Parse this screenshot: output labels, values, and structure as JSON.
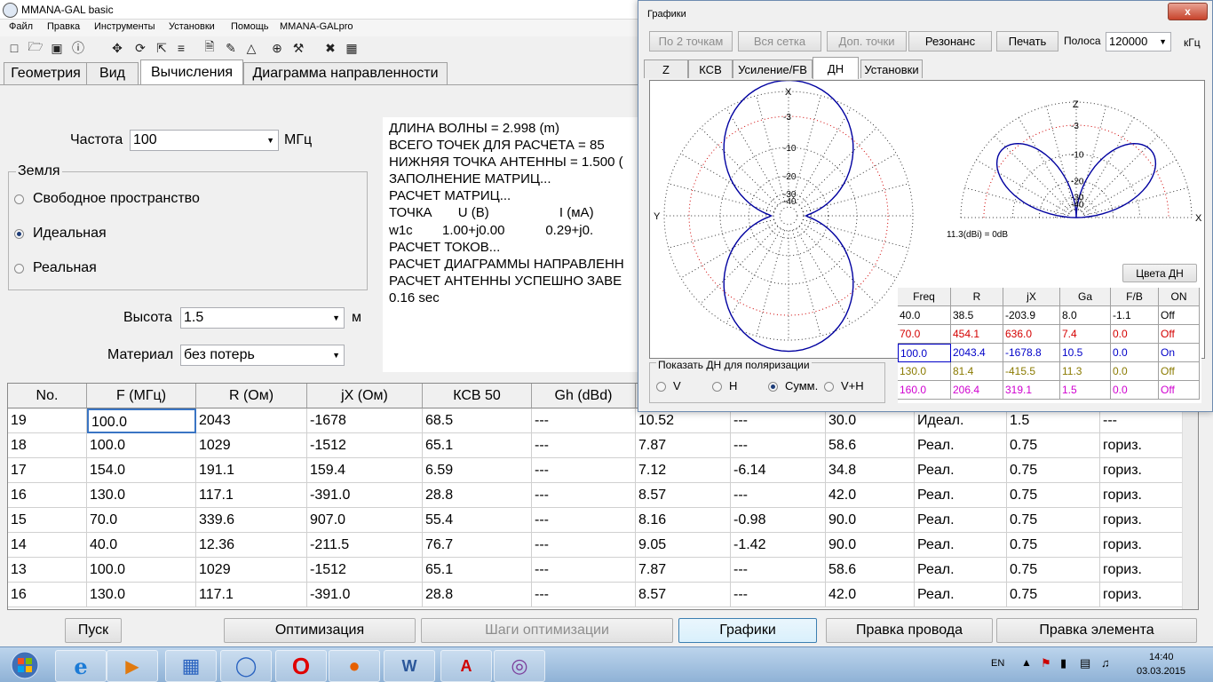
{
  "window": {
    "title": "MMANA-GAL basic"
  },
  "menu": [
    "Файл",
    "Правка",
    "Инструменты",
    "Установки",
    "Помощь",
    "MMANA-GALpro"
  ],
  "tabs": [
    "Геометрия",
    "Вид",
    "Вычисления",
    "Диаграмма направленности"
  ],
  "calc": {
    "freq_label": "Частота",
    "freq_value": "100",
    "freq_unit": "МГц",
    "ground_title": "Земля",
    "ground_options": [
      "Свободное пространство",
      "Идеальная",
      "Реальная"
    ],
    "ground_selected": 1,
    "height_label": "Высота",
    "height_value": "1.5",
    "height_unit": "м",
    "material_label": "Материал",
    "material_value": "без потерь"
  },
  "log": [
    "ДЛИНА ВОЛНЫ = 2.998 (m)",
    "ВСЕГО ТОЧЕК ДЛЯ РАСЧЕТА = 85",
    "НИЖНЯЯ ТОЧКА АНТЕННЫ = 1.500 (",
    "ЗАПОЛНЕНИЕ МАТРИЦ...",
    "РАСЧЕТ МАТРИЦ...",
    "ТОЧКА       U (В)                   I (мА)",
    "w1c        1.00+j0.00           0.29+j0.",
    "РАСЧЕТ ТОКОВ...",
    "РАСЧЕТ ДИАГРАММЫ НАПРАВЛЕНН",
    "РАСЧЕТ АНТЕННЫ УСПЕШНО ЗАВЕ",
    "0.16 sec"
  ],
  "grid": {
    "headers": [
      "No.",
      "F (МГц)",
      "R (Ом)",
      "jX (Ом)",
      "КСВ 50",
      "Gh (dBd)"
    ],
    "rows": [
      [
        "19",
        "100.0",
        "2043",
        "-1678",
        "68.5",
        "---",
        "10.52",
        "---",
        "30.0",
        "Идеал.",
        "1.5",
        "---"
      ],
      [
        "18",
        "100.0",
        "1029",
        "-1512",
        "65.1",
        "---",
        "7.87",
        "---",
        "58.6",
        "Реал.",
        "0.75",
        "гориз."
      ],
      [
        "17",
        "154.0",
        "191.1",
        "159.4",
        "6.59",
        "---",
        "7.12",
        "-6.14",
        "34.8",
        "Реал.",
        "0.75",
        "гориз."
      ],
      [
        "16",
        "130.0",
        "117.1",
        "-391.0",
        "28.8",
        "---",
        "8.57",
        "---",
        "42.0",
        "Реал.",
        "0.75",
        "гориз."
      ],
      [
        "15",
        "70.0",
        "339.6",
        "907.0",
        "55.4",
        "---",
        "8.16",
        "-0.98",
        "90.0",
        "Реал.",
        "0.75",
        "гориз."
      ],
      [
        "14",
        "40.0",
        "12.36",
        "-211.5",
        "76.7",
        "---",
        "9.05",
        "-1.42",
        "90.0",
        "Реал.",
        "0.75",
        "гориз."
      ],
      [
        "13",
        "100.0",
        "1029",
        "-1512",
        "65.1",
        "---",
        "7.87",
        "---",
        "58.6",
        "Реал.",
        "0.75",
        "гориз."
      ],
      [
        "16",
        "130.0",
        "117.1",
        "-391.0",
        "28.8",
        "---",
        "8.57",
        "---",
        "42.0",
        "Реал.",
        "0.75",
        "гориз."
      ]
    ]
  },
  "buttons": [
    "Пуск",
    "Оптимизация",
    "Шаги оптимизации",
    "Графики",
    "Правка провода",
    "Правка элемента"
  ],
  "graphics": {
    "title": "Графики",
    "close_label": "x",
    "toolbar": [
      "По 2 точкам",
      "Вся сетка",
      "Доп. точки",
      "Резонанс",
      "Печать"
    ],
    "band_label": "Полоса",
    "band_value": "120000",
    "band_unit": "кГц",
    "tabs": [
      "Z",
      "КСВ",
      "Усиление/FB",
      "ДН",
      "Установки"
    ],
    "polar_left": {
      "top": "X",
      "left": "Y",
      "rings": [
        "3",
        "10",
        "20",
        "30",
        "40"
      ]
    },
    "polar_right": {
      "top": "Z",
      "right": "X",
      "rings": [
        "3",
        "10",
        "20",
        "30",
        "40"
      ]
    },
    "gain_note": "11.3(dBi) = 0dB",
    "colors_button": "Цвета ДН",
    "polarization_title": "Показать ДН для поляризации",
    "polarization_options": [
      "V",
      "H",
      "Сумм.",
      "V+H"
    ],
    "polarization_selected": 2,
    "table_headers": [
      "Freq",
      "R",
      "jX",
      "Ga",
      "F/B",
      "ON"
    ],
    "table_rows": [
      [
        "40.0",
        "38.5",
        "-203.9",
        "8.0",
        "-1.1",
        "Off"
      ],
      [
        "70.0",
        "454.1",
        "636.0",
        "7.4",
        "0.0",
        "Off"
      ],
      [
        "100.0",
        "2043.4",
        "-1678.8",
        "10.5",
        "0.0",
        "On"
      ],
      [
        "130.0",
        "81.4",
        "-415.5",
        "11.3",
        "0.0",
        "Off"
      ],
      [
        "160.0",
        "206.4",
        "319.1",
        "1.5",
        "0.0",
        "Off"
      ]
    ],
    "row_colors": [
      "#000000",
      "#d40000",
      "#0000c8",
      "#8a7a00",
      "#d000d0"
    ],
    "pattern_color": "#0000a0",
    "ring_color": "#d00000"
  },
  "taskbar": {
    "lang": "EN",
    "time": "14:40",
    "date": "03.03.2015"
  }
}
